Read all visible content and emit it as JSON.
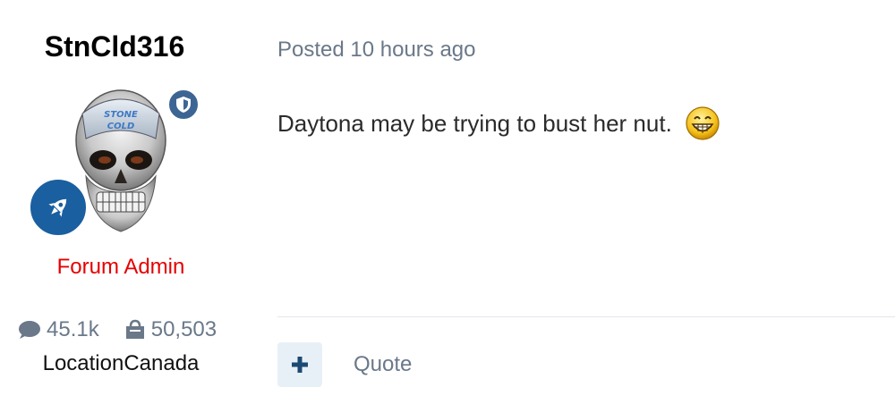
{
  "author": {
    "username": "StnCld316",
    "group_title": "Forum Admin",
    "stats": {
      "posts": "45.1k",
      "reputation": "50,503"
    },
    "location": "LocationCanada"
  },
  "post": {
    "meta": "Posted 10 hours ago",
    "body": "Daytona may be trying to bust her nut."
  },
  "actions": {
    "quote_label": "Quote"
  },
  "colors": {
    "group_title": "#e60000",
    "muted_text": "#6a7889",
    "badge_blue": "#1a5fa0",
    "mod_badge": "#3d6594",
    "multiquote_bg": "#e8f0f7"
  },
  "icons": {
    "posts": "comment-icon",
    "reputation": "bag-icon",
    "moderator": "shield-icon",
    "rank": "rocket-icon",
    "multiquote": "plus-icon",
    "emoji": "grin-emoji-icon"
  }
}
